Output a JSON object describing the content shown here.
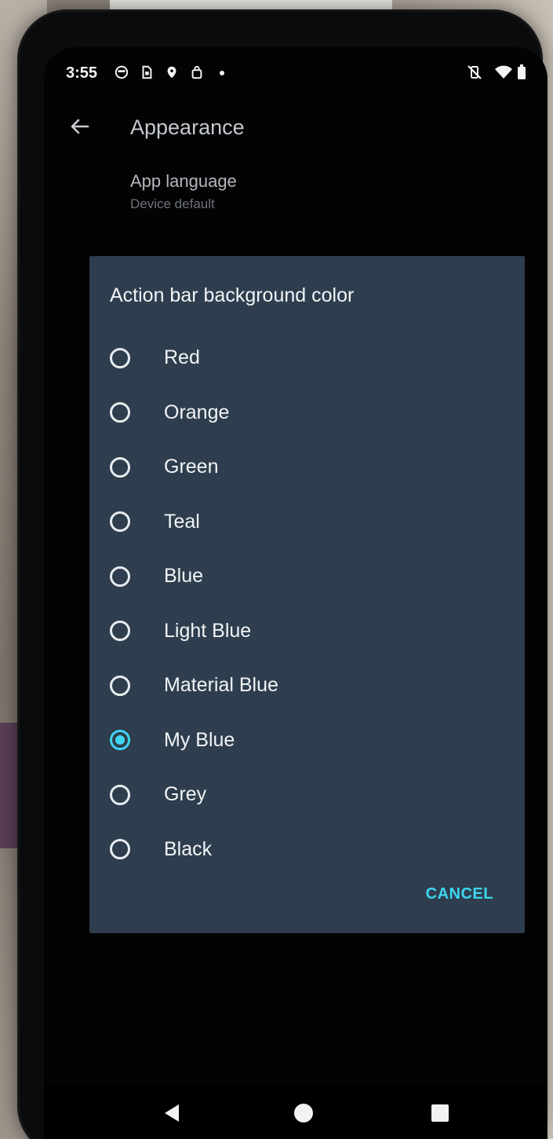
{
  "status_bar": {
    "time": "3:55"
  },
  "toolbar": {
    "title": "Appearance"
  },
  "settings": {
    "app_language": {
      "title": "App language",
      "value": "Device default"
    }
  },
  "dialog": {
    "title": "Action bar background color",
    "options": [
      {
        "label": "Red",
        "selected": false
      },
      {
        "label": "Orange",
        "selected": false
      },
      {
        "label": "Green",
        "selected": false
      },
      {
        "label": "Teal",
        "selected": false
      },
      {
        "label": "Blue",
        "selected": false
      },
      {
        "label": "Light Blue",
        "selected": false
      },
      {
        "label": "Material Blue",
        "selected": false
      },
      {
        "label": "My Blue",
        "selected": true
      },
      {
        "label": "Grey",
        "selected": false
      },
      {
        "label": "Black",
        "selected": false
      }
    ],
    "cancel_label": "CANCEL"
  },
  "colors": {
    "dialog_background": "#2e3e4e",
    "accent": "#3fd6f0",
    "screen_background": "#030304"
  },
  "icons": {
    "back": "arrow-back-icon",
    "nav_back": "triangle-back-icon",
    "nav_home": "circle-home-icon",
    "nav_recents": "square-recents-icon"
  }
}
